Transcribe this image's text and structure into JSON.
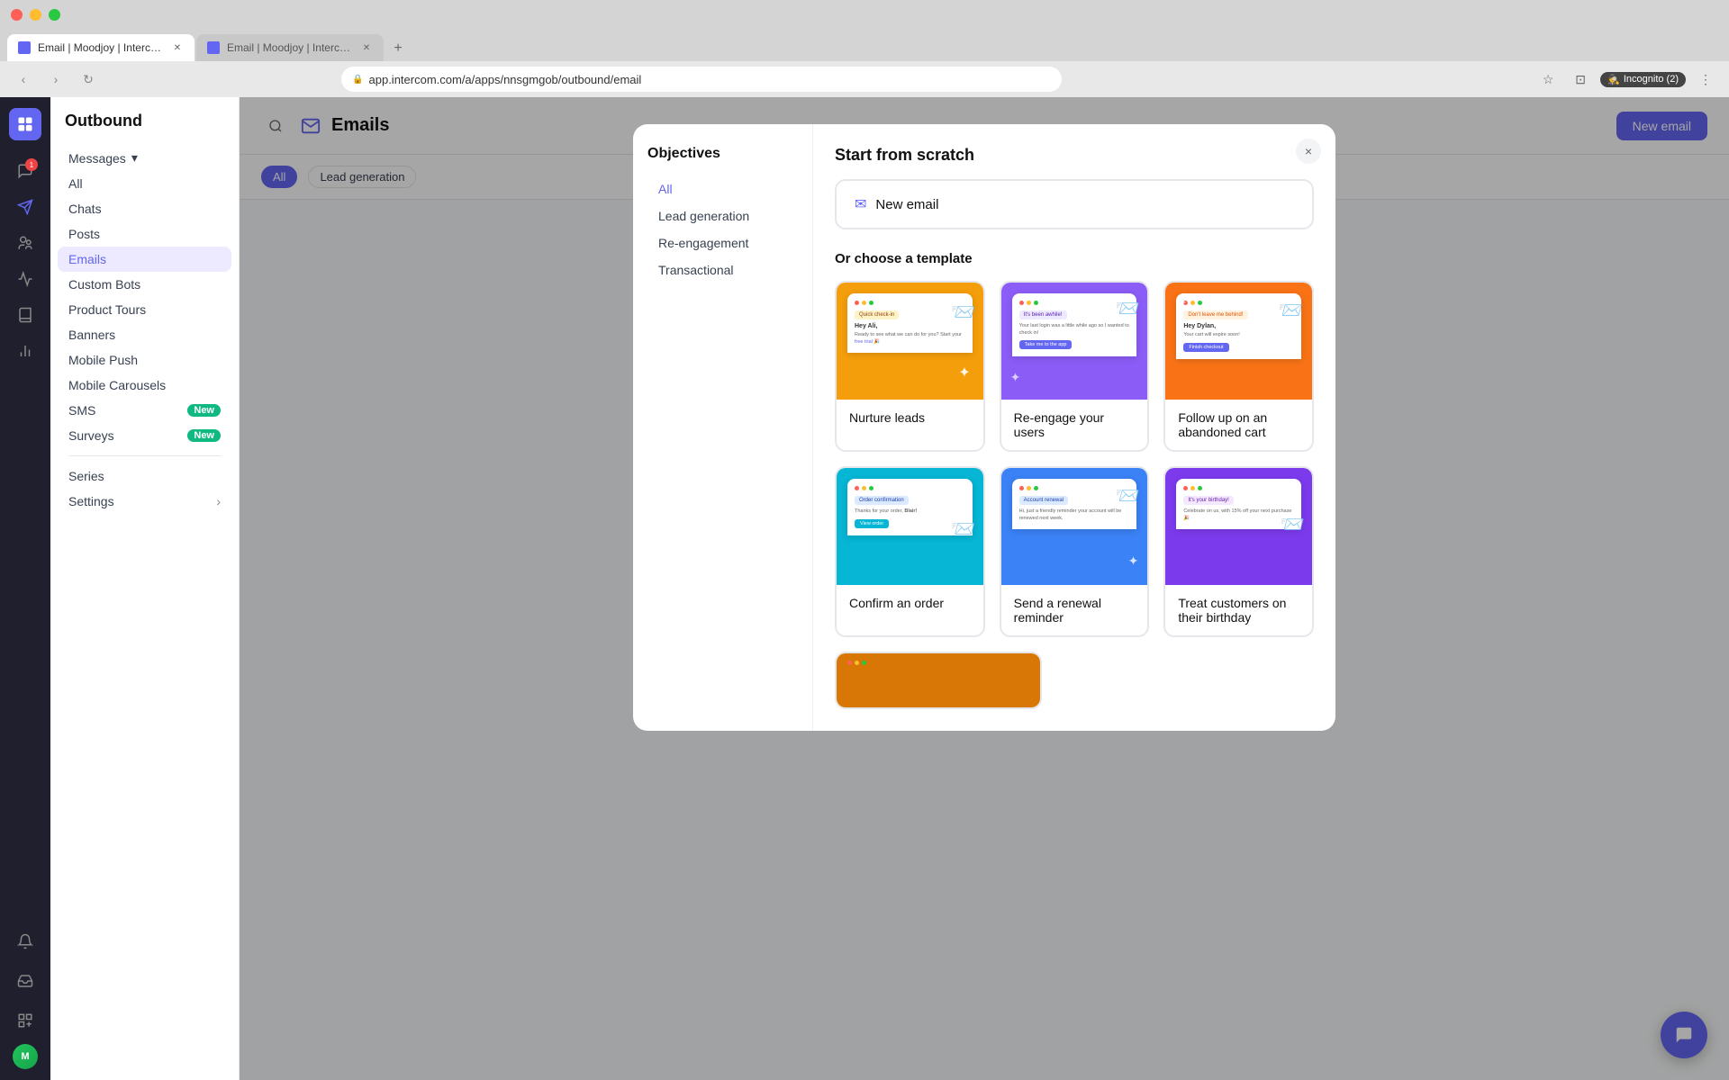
{
  "browser": {
    "tabs": [
      {
        "id": "tab1",
        "title": "Email | Moodjoy | Intercom",
        "active": true
      },
      {
        "id": "tab2",
        "title": "Email | Moodjoy | Intercom",
        "active": false
      }
    ],
    "url": "app.intercom.com/a/apps/nnsgmgob/outbound/email",
    "incognito_label": "Incognito (2)"
  },
  "app": {
    "section": "Outbound",
    "page_title": "Emails",
    "new_email_btn": "New email"
  },
  "sidebar": {
    "messages_label": "Messages",
    "items": [
      {
        "id": "all",
        "label": "All"
      },
      {
        "id": "chats",
        "label": "Chats"
      },
      {
        "id": "posts",
        "label": "Posts"
      },
      {
        "id": "emails",
        "label": "Emails",
        "active": true
      },
      {
        "id": "custom-bots",
        "label": "Custom Bots"
      },
      {
        "id": "product-tours",
        "label": "Product Tours"
      },
      {
        "id": "banners",
        "label": "Banners"
      },
      {
        "id": "mobile-push",
        "label": "Mobile Push"
      },
      {
        "id": "mobile-carousels",
        "label": "Mobile Carousels"
      },
      {
        "id": "sms",
        "label": "SMS",
        "badge": "New"
      },
      {
        "id": "surveys",
        "label": "Surveys",
        "badge": "New"
      }
    ],
    "series_label": "Series",
    "settings_label": "Settings"
  },
  "modal": {
    "close_btn": "×",
    "scratch_section_title": "Start from scratch",
    "new_email_label": "New email",
    "template_section_title": "Or choose a template",
    "objectives": {
      "title": "Objectives",
      "items": [
        {
          "id": "all",
          "label": "All",
          "active": true
        },
        {
          "id": "lead-generation",
          "label": "Lead generation"
        },
        {
          "id": "re-engagement",
          "label": "Re-engagement"
        },
        {
          "id": "transactional",
          "label": "Transactional"
        }
      ]
    },
    "templates": [
      {
        "id": "nurture-leads",
        "label": "Nurture leads",
        "preview_bg": "yellow",
        "preview_label": "Quick check-in",
        "preview_text": "Hey Ali,",
        "preview_body": "Ready to see what we can do for you? Start your free trial 🎉"
      },
      {
        "id": "re-engage-users",
        "label": "Re-engage your users",
        "preview_bg": "purple",
        "preview_label": "It's been awhile!",
        "preview_text": "",
        "preview_body": "Your last login was a little while ago so I wanted to check in!"
      },
      {
        "id": "abandoned-cart",
        "label": "Follow up on an abandoned cart",
        "preview_bg": "orange",
        "preview_label": "Don't leave me behind!",
        "preview_text": "Hey Dylan,",
        "preview_body": "Your cart will expire soon!"
      },
      {
        "id": "confirm-order",
        "label": "Confirm an order",
        "preview_bg": "green-blue",
        "preview_label": "Order confirmation",
        "preview_text": "Thanks for your order, Blair!",
        "preview_body": ""
      },
      {
        "id": "renewal-reminder",
        "label": "Send a renewal reminder",
        "preview_bg": "blue",
        "preview_label": "Account renewal",
        "preview_text": "",
        "preview_body": "Hi, just a friendly reminder your account will be renewed next week."
      },
      {
        "id": "birthday",
        "label": "Treat customers on their birthday",
        "preview_bg": "violet",
        "preview_label": "It's your birthday!",
        "preview_text": "",
        "preview_body": "Celebrate on us, with 15% off your next purchase 🎉"
      }
    ],
    "scroll_more_preview_bg": "gold"
  },
  "filter_bar": {
    "chips": [
      {
        "label": "All",
        "active": true
      },
      {
        "label": "Lead generation",
        "active": false
      }
    ]
  },
  "icons": {
    "search": "🔍",
    "email_page": "✉",
    "close": "✕",
    "chevron_down": "▾",
    "envelope": "✉",
    "star4": "✦",
    "star4_small": "✦"
  }
}
